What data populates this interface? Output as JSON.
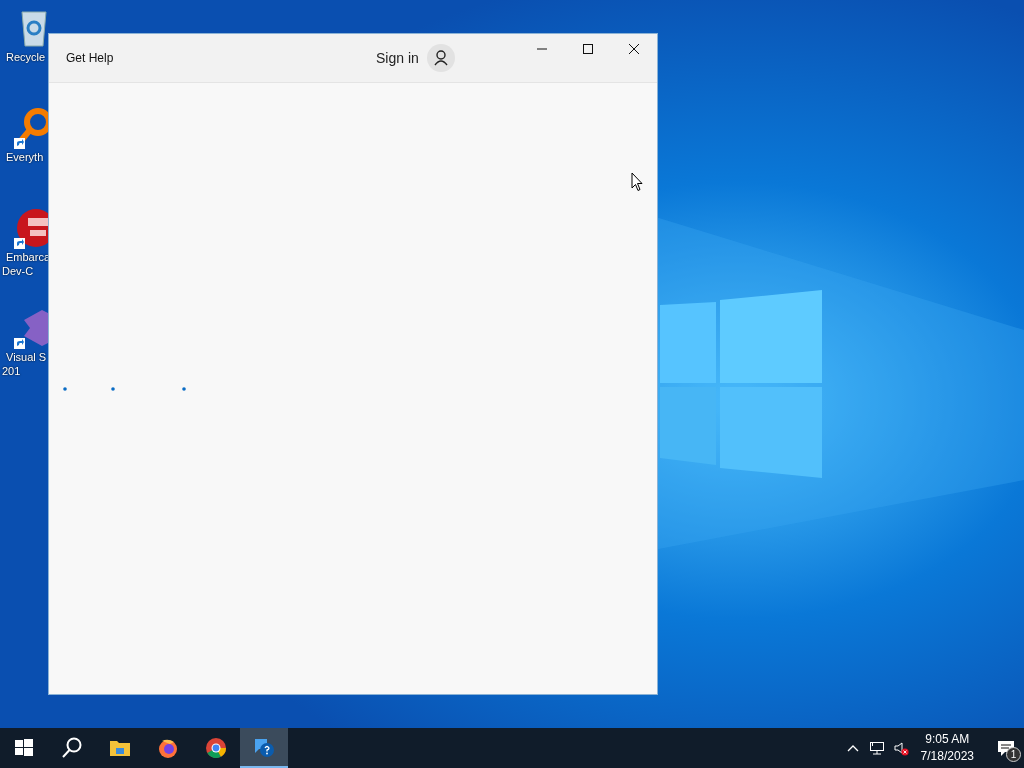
{
  "desktop": {
    "icons": [
      {
        "kind": "recycle-bin",
        "lines": [
          "Recycle"
        ],
        "shortcut": false
      },
      {
        "kind": "magnifier",
        "lines": [
          "Everyth"
        ],
        "shortcut": true
      },
      {
        "kind": "devcpp",
        "lines": [
          "Embarca",
          "Dev-C"
        ],
        "shortcut": true
      },
      {
        "kind": "visual-studio",
        "lines": [
          "Visual S",
          "201"
        ],
        "shortcut": true
      }
    ]
  },
  "window": {
    "title": "Get Help",
    "sign_in": "Sign in"
  },
  "taskbar": {
    "apps": [
      {
        "kind": "start",
        "selected": false
      },
      {
        "kind": "search",
        "selected": false
      },
      {
        "kind": "folder",
        "selected": false
      },
      {
        "kind": "firefox",
        "selected": false
      },
      {
        "kind": "chrome",
        "selected": false
      },
      {
        "kind": "help",
        "selected": true
      }
    ],
    "tray": {
      "volume_muted": true,
      "time": "9:05 AM",
      "date": "7/18/2023",
      "notification_count": "1"
    }
  }
}
